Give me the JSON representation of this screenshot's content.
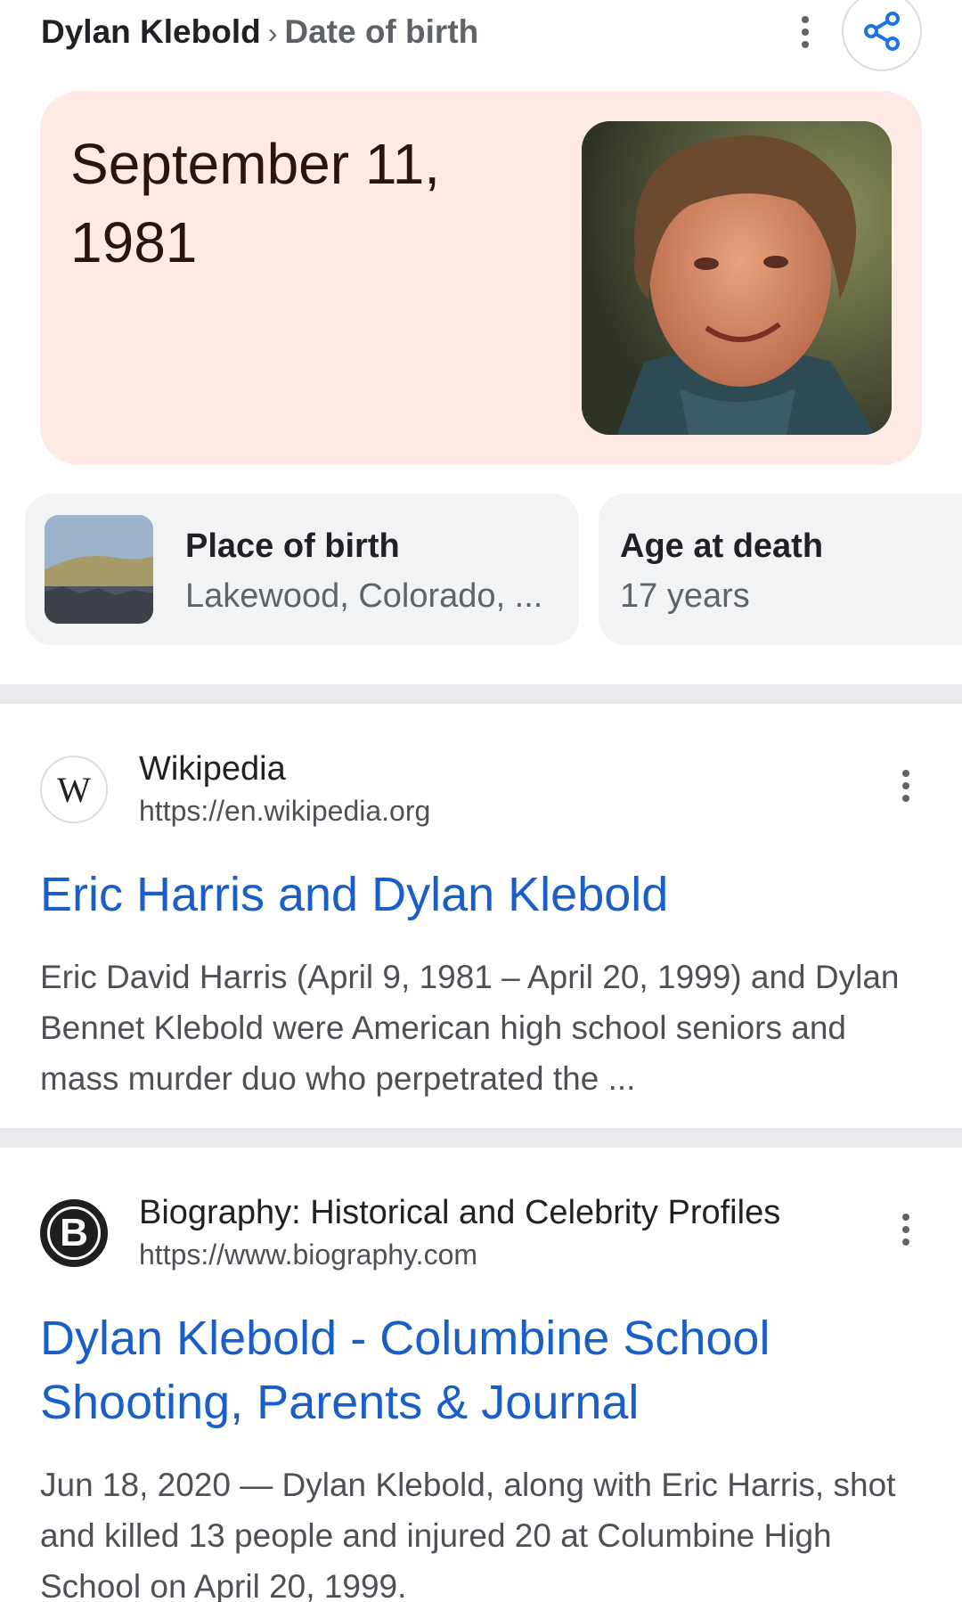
{
  "header": {
    "entity": "Dylan Klebold",
    "separator": "›",
    "attribute": "Date of birth"
  },
  "answer": {
    "value": "September 11, 1981"
  },
  "attributes": [
    {
      "title": "Place of birth",
      "value": "Lakewood, Colorado, ..."
    },
    {
      "title": "Age at death",
      "value": "17 years"
    }
  ],
  "results": [
    {
      "site_name": "Wikipedia",
      "url": "https://en.wikipedia.org",
      "favicon_letter": "W",
      "title": "Eric Harris and Dylan Klebold",
      "snippet": "Eric David Harris (April 9, 1981 – April 20, 1999) and Dylan Bennet Klebold were American high school seniors and mass murder duo who perpetrated the ..."
    },
    {
      "site_name": "Biography: Historical and Celebrity Profiles",
      "url": "https://www.biography.com",
      "favicon_letter": "B",
      "title": "Dylan Klebold - Columbine School Shooting, Parents & Journal",
      "snippet": "Jun 18, 2020 — Dylan Klebold, along with Eric Harris, shot and killed 13 people and injured 20 at Columbine High School on April 20, 1999."
    }
  ],
  "icons": {
    "menu": "more-vert-icon",
    "share": "share-icon"
  },
  "colors": {
    "answer_card_bg": "#fdeae5",
    "link_blue": "#1a5fc8",
    "chip_bg": "#f1f3f4",
    "divider": "#e8eaed",
    "share_blue": "#1a73e8"
  }
}
